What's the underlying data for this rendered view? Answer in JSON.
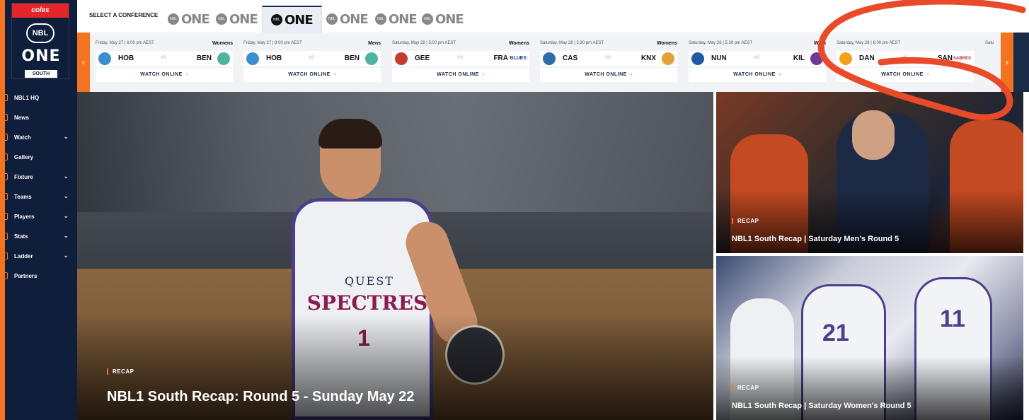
{
  "sidebar": {
    "logo": {
      "brand": "coles",
      "badge": "NBL",
      "one": "ONE",
      "region": "SOUTH"
    },
    "items": [
      {
        "label": "NBL1 HQ",
        "icon": "home-icon",
        "has_chevron": false
      },
      {
        "label": "News",
        "icon": "news-icon",
        "has_chevron": false
      },
      {
        "label": "Watch",
        "icon": "watch-icon",
        "has_chevron": true
      },
      {
        "label": "Gallery",
        "icon": "gallery-icon",
        "has_chevron": false
      },
      {
        "label": "Fixture",
        "icon": "fixture-icon",
        "has_chevron": true
      },
      {
        "label": "Teams",
        "icon": "teams-icon",
        "has_chevron": true
      },
      {
        "label": "Players",
        "icon": "players-icon",
        "has_chevron": true
      },
      {
        "label": "Stats",
        "icon": "stats-icon",
        "has_chevron": true
      },
      {
        "label": "Ladder",
        "icon": "ladder-icon",
        "has_chevron": true
      },
      {
        "label": "Partners",
        "icon": "partners-icon",
        "has_chevron": false
      }
    ]
  },
  "conference": {
    "label": "SELECT A CONFERENCE",
    "tabs": [
      {
        "badge": "NBL",
        "label": "ONE",
        "active": false
      },
      {
        "badge": "NBL",
        "label": "ONE",
        "active": false
      },
      {
        "badge": "NBL",
        "label": "ONE",
        "active": true
      },
      {
        "badge": "NBL",
        "label": "ONE",
        "active": false
      },
      {
        "badge": "NBL",
        "label": "ONE",
        "active": false
      },
      {
        "badge": "NBL",
        "label": "ONE",
        "active": false
      }
    ]
  },
  "fixtures": {
    "prev": "‹",
    "next": "›",
    "cards": [
      {
        "meta": "Friday, May 27 | 6:00 pm AEST",
        "category": "Womens",
        "home": "HOB",
        "vs": "VS",
        "away": "BEN",
        "watch": "WATCH ONLINE",
        "arrow": "›",
        "home_color": "#3a8fd1",
        "away_color": "#4fb3a2"
      },
      {
        "meta": "Friday, May 27 | 8:00 pm AEST",
        "category": "Mens",
        "home": "HOB",
        "vs": "VS",
        "away": "BEN",
        "watch": "WATCH ONLINE",
        "arrow": "›",
        "home_color": "#3a8fd1",
        "away_color": "#4fb3a2"
      },
      {
        "meta": "Saturday, May 28 | 5:00 pm AEST",
        "category": "Womens",
        "home": "GEE",
        "vs": "VS",
        "away": "FRA",
        "watch": "WATCH ONLINE",
        "arrow": "›",
        "home_color": "#c43c2c",
        "away_color": "#1b3a7a",
        "away_text": "BLUES"
      },
      {
        "meta": "Saturday, May 28 | 5:30 pm AEST",
        "category": "Womens",
        "home": "CAS",
        "vs": "VS",
        "away": "KNX",
        "watch": "WATCH ONLINE",
        "arrow": "›",
        "home_color": "#2c6fa8",
        "away_color": "#e2a23a"
      },
      {
        "meta": "Saturday, May 28 | 5:30 pm AEST",
        "category": "Wom",
        "home": "NUN",
        "vs": "VS",
        "away": "KIL",
        "watch": "WATCH ONLINE",
        "arrow": "›",
        "home_color": "#1f5aa5",
        "away_color": "#6d3b8f"
      },
      {
        "meta": "Saturday, May 28 | 6:00 pm AEST",
        "category": "",
        "home": "DAN",
        "vs": "VS",
        "away": "SAN",
        "watch": "WATCH ONLINE",
        "arrow": "›",
        "home_color": "#f2a21a",
        "away_color": "#c2262c",
        "away_text": "SABRES"
      }
    ],
    "partial_meta": "Satu"
  },
  "hero": {
    "tag": "RECAP",
    "title": "NBL1 South Recap: Round 5 - Sunday May 22",
    "jersey_sponsor": "QUEST",
    "jersey_team": "SPECTRES",
    "jersey_number": "1"
  },
  "side_cards": [
    {
      "tag": "RECAP",
      "title": "NBL1 South Recap | Saturday Men's Round 5"
    },
    {
      "tag": "RECAP",
      "title": "NBL1 South Recap | Saturday Women's Round 5",
      "numbers": [
        "21",
        "11"
      ]
    }
  ],
  "colors": {
    "accent": "#f47321",
    "navy": "#0f1e3a",
    "annotation": "#e84a2a"
  }
}
